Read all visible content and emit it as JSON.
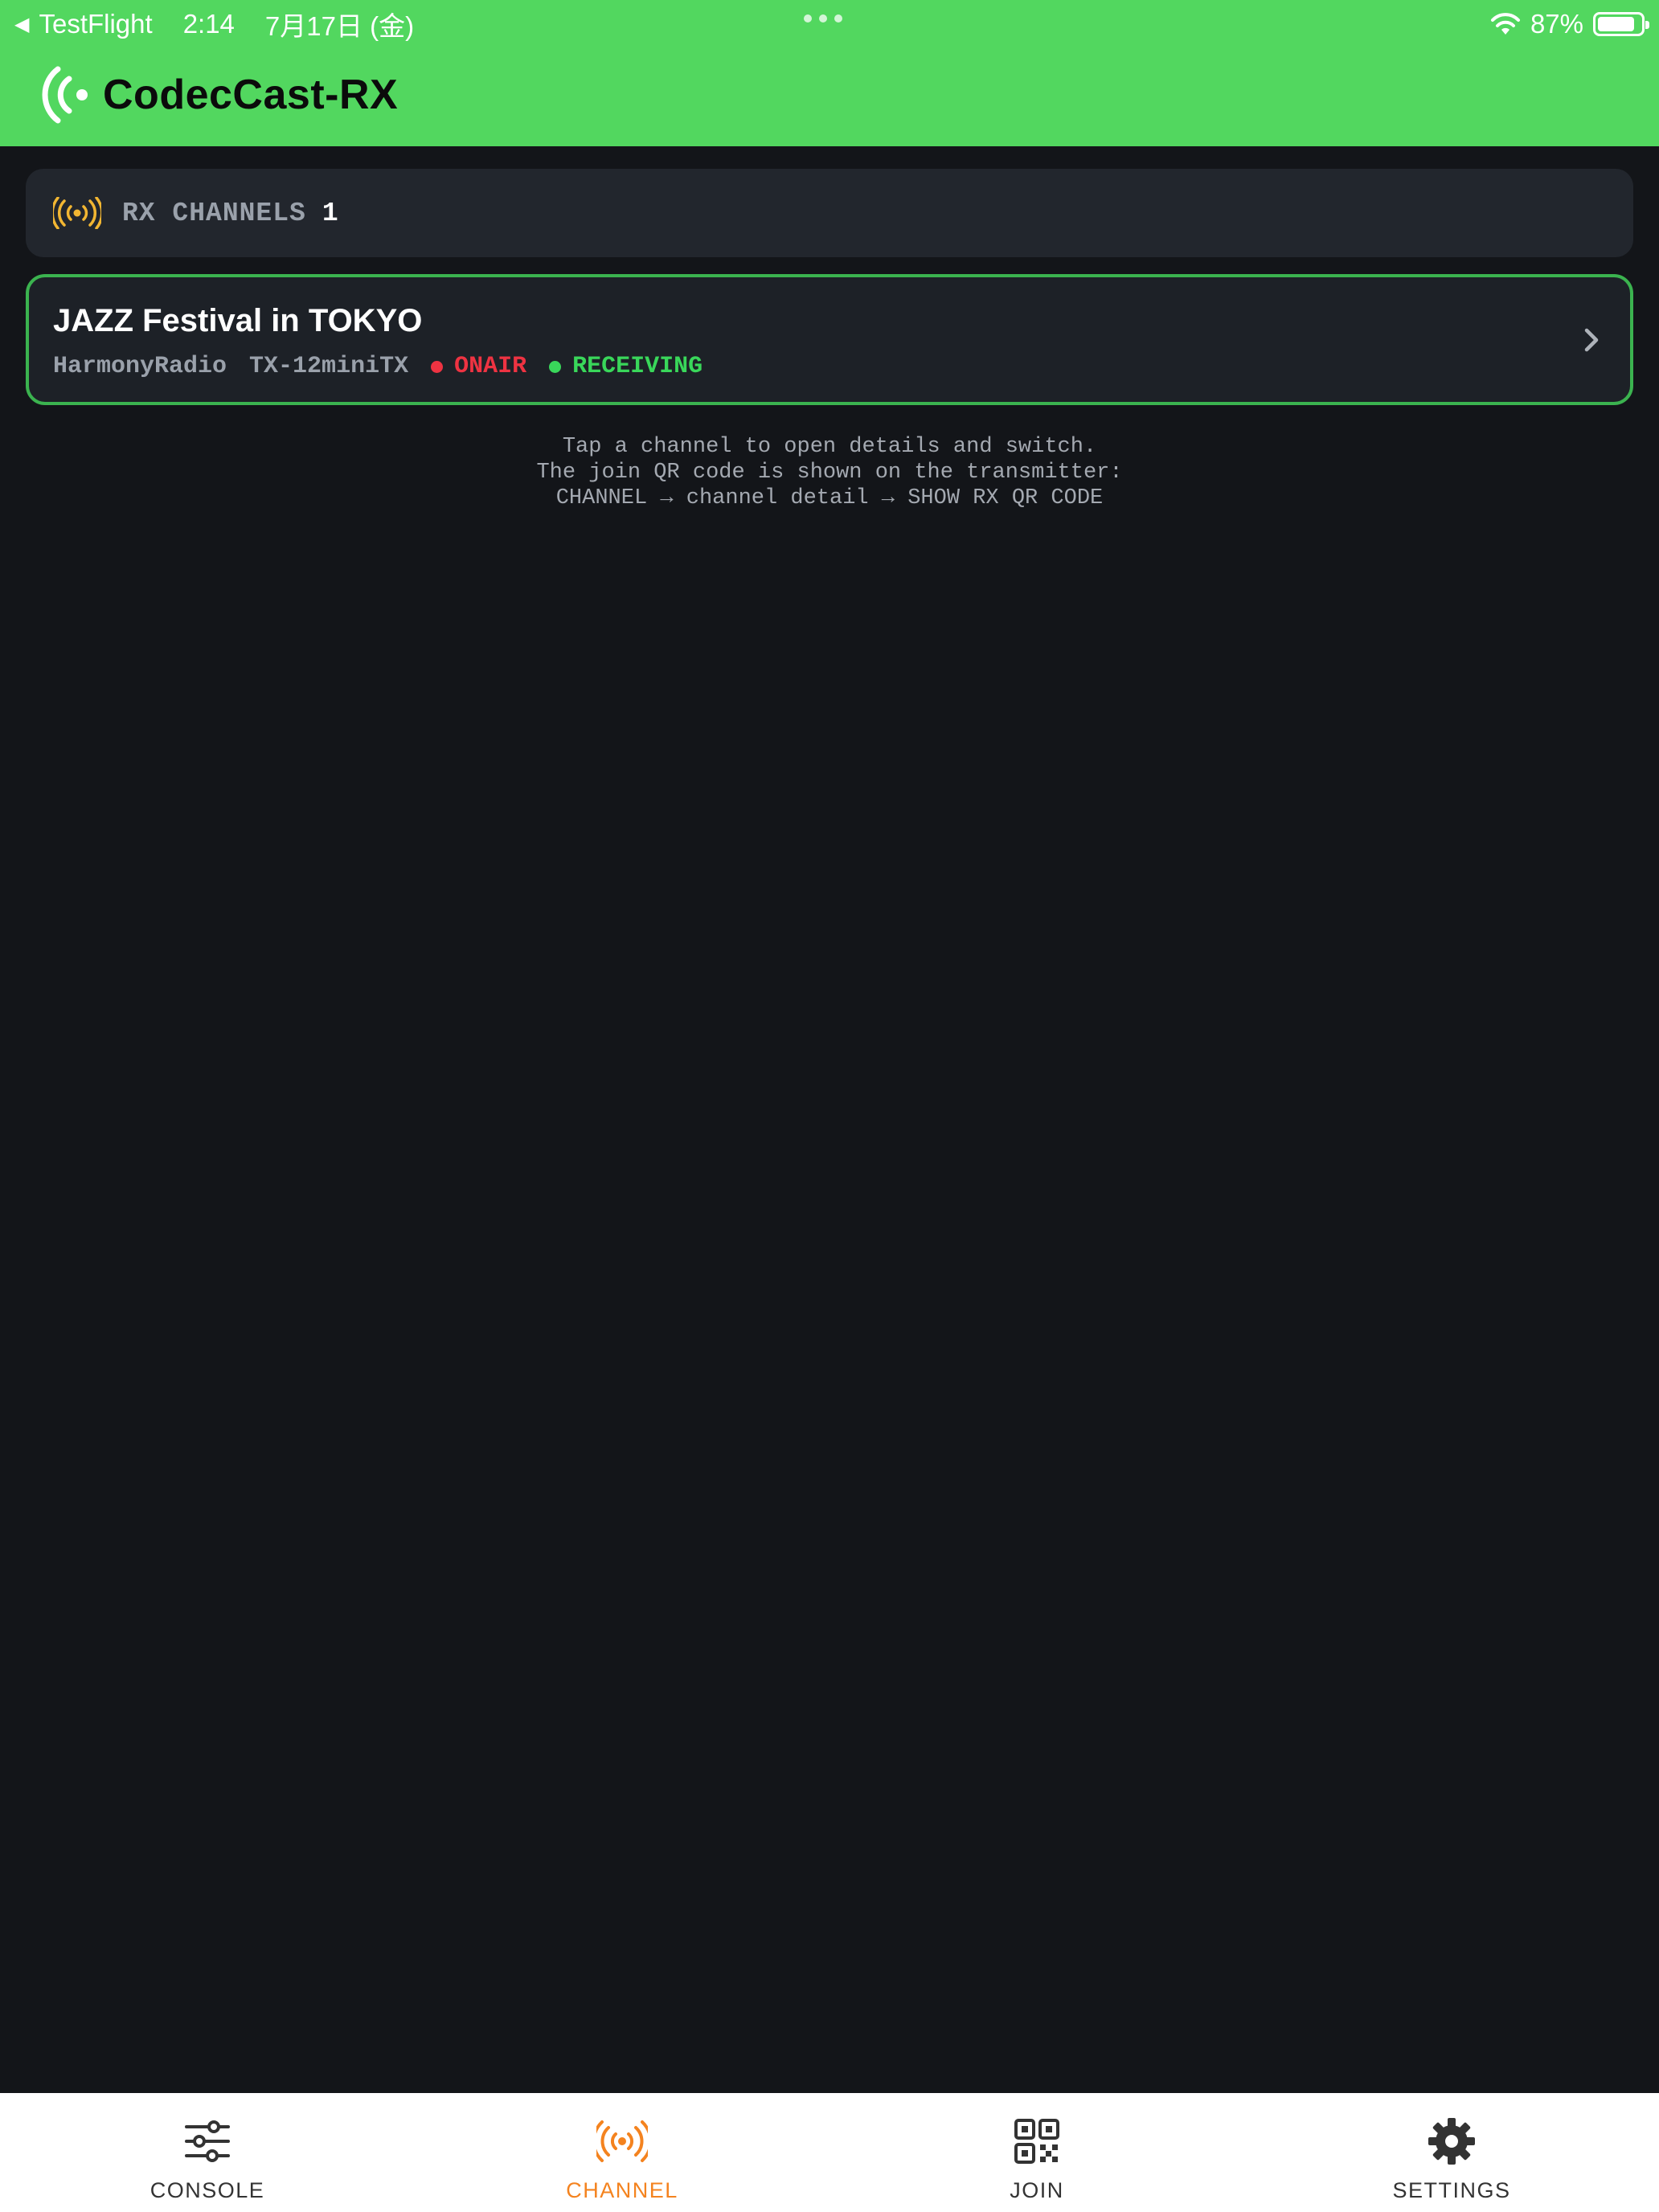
{
  "status_bar": {
    "back_app": "TestFlight",
    "time": "2:14",
    "date": "7月17日 (金)",
    "battery": "87%",
    "battery_level": 0.87
  },
  "app": {
    "title": "CodecCast-RX",
    "header_color": "#52d75f"
  },
  "rx_header": {
    "label": "RX CHANNELS",
    "count": "1",
    "icon": "broadcast-icon"
  },
  "channels": [
    {
      "name": "JAZZ Festival in TOKYO",
      "station": "HarmonyRadio",
      "transmitter": "TX-12miniTX",
      "onair_label": "ONAIR",
      "onair_color": "#ee3342",
      "receiving_label": "RECEIVING",
      "receiving_color": "#39d75a"
    }
  ],
  "hint": {
    "line1": "Tap a channel to open details and switch.",
    "line2": "The join QR code is shown on the transmitter:",
    "line3": "CHANNEL → channel detail → SHOW RX QR CODE"
  },
  "tabs": [
    {
      "label": "CONSOLE",
      "icon": "sliders-icon",
      "active": false
    },
    {
      "label": "CHANNEL",
      "icon": "broadcast-icon",
      "active": true
    },
    {
      "label": "JOIN",
      "icon": "qr-code-icon",
      "active": false
    },
    {
      "label": "SETTINGS",
      "icon": "gear-icon",
      "active": false
    }
  ],
  "colors": {
    "accent_orange": "#f4831f",
    "card_border": "#3bb34f",
    "rx_icon": "#f2b632"
  }
}
